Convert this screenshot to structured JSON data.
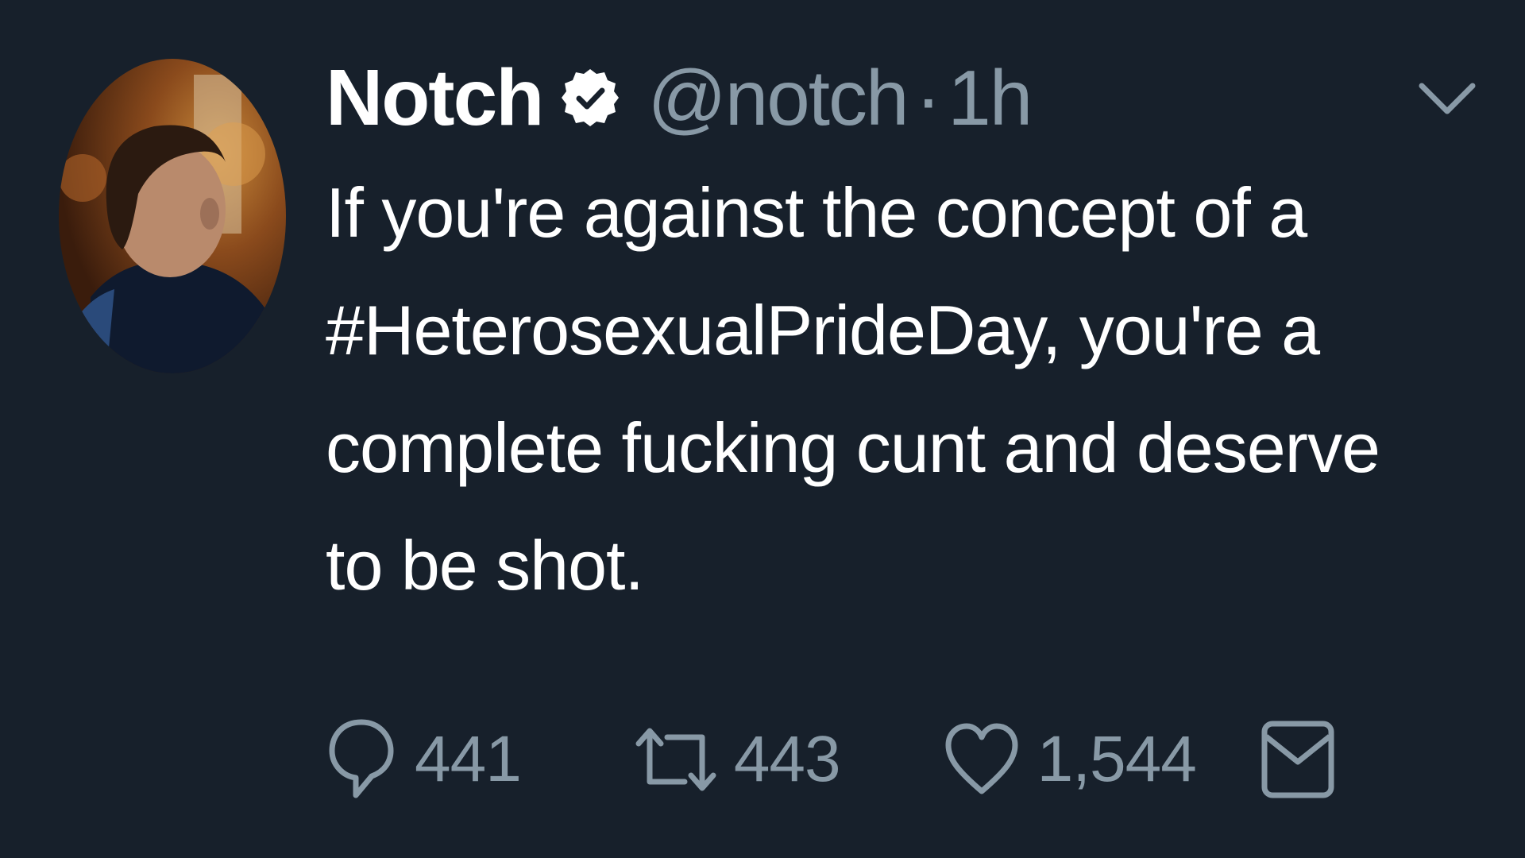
{
  "tweet": {
    "display_name": "Notch",
    "handle": "@notch",
    "separator": "·",
    "time": "1h",
    "text": "If you're against the concept of a\n#HeterosexualPrideDay, you're a\ncomplete fucking cunt and deserve\nto be shot.",
    "verified_icon": "verified-badge-icon",
    "caret_icon": "chevron-down-icon"
  },
  "actions": {
    "reply_count": "441",
    "retweet_count": "443",
    "like_count": "1,544"
  },
  "colors": {
    "background": "#17202b",
    "text_primary": "#ffffff",
    "text_secondary": "#8899a6"
  }
}
